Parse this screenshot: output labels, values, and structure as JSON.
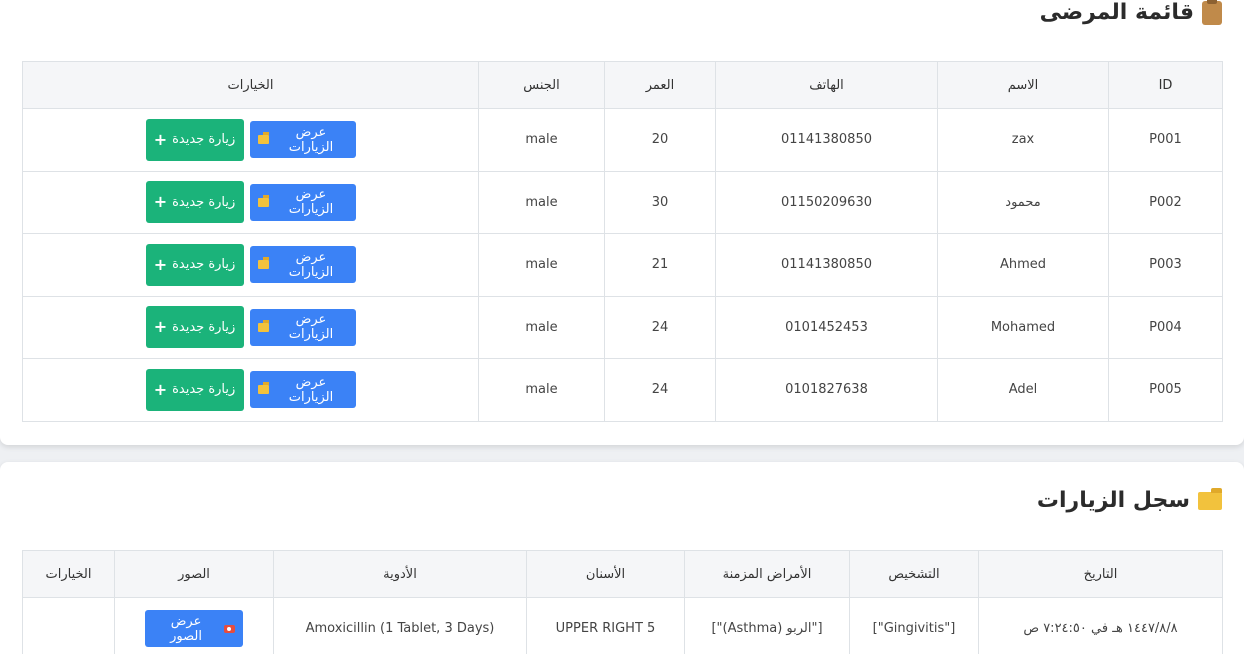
{
  "patients": {
    "title": "قائمة المرضى",
    "headers": {
      "id": "ID",
      "name": "الاسم",
      "phone": "الهاتف",
      "age": "العمر",
      "gender": "الجنس",
      "options": "الخيارات"
    },
    "view_visits_label": "عرض الزيارات",
    "new_visit_label": "زيارة جديدة",
    "rows": [
      {
        "id": "P001",
        "name": "zax",
        "phone": "01141380850",
        "age": "20",
        "gender": "male"
      },
      {
        "id": "P002",
        "name": "محمود",
        "phone": "01150209630",
        "age": "30",
        "gender": "male"
      },
      {
        "id": "P003",
        "name": "Ahmed",
        "phone": "01141380850",
        "age": "21",
        "gender": "male"
      },
      {
        "id": "P004",
        "name": "Mohamed",
        "phone": "0101452453",
        "age": "24",
        "gender": "male"
      },
      {
        "id": "P005",
        "name": "Adel",
        "phone": "0101827638",
        "age": "24",
        "gender": "male"
      }
    ]
  },
  "visits": {
    "title": "سجل الزيارات",
    "headers": {
      "date": "التاريخ",
      "diagnosis": "التشخيص",
      "chronic": "الأمراض المزمنة",
      "teeth": "الأسنان",
      "medications": "الأدوية",
      "images": "الصور",
      "options": "الخيارات"
    },
    "view_images_label": "عرض الصور",
    "rows": [
      {
        "date": "١٤٤٧/٨/٨ هـ في ٧:٢٤:٥٠ ص",
        "diagnosis": "[\"Gingivitis\"]",
        "chronic": "[\"الربو (Asthma)\"]",
        "teeth": "UPPER RIGHT 5",
        "medications": "Amoxicillin (1 Tablet, 3 Days)"
      }
    ]
  },
  "icons": {
    "patients_title_icon": "clipboard-icon",
    "visits_title_icon": "folder-open-icon",
    "view_visits_icon": "folder-open-icon",
    "new_visit_icon": "plus-icon",
    "view_images_icon": "camera-icon"
  },
  "colors": {
    "primary_blue": "#3b82f6",
    "success_green": "#1bb37a",
    "header_bg": "#f5f6f8"
  }
}
